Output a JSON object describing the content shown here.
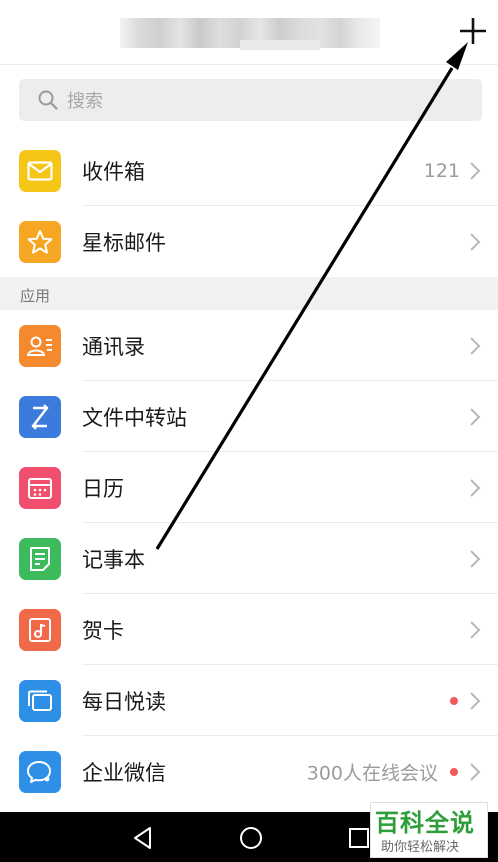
{
  "header": {
    "title_redacted": true,
    "add_icon": "plus-icon"
  },
  "search": {
    "placeholder": "搜索",
    "icon": "search-icon"
  },
  "mail_items": [
    {
      "label": "收件箱",
      "count": "121",
      "icon": "envelope-icon",
      "color": "#F5C518"
    },
    {
      "label": "星标邮件",
      "count": "",
      "icon": "star-icon",
      "color": "#F5A623"
    }
  ],
  "apps_section": {
    "title": "应用"
  },
  "apps": [
    {
      "label": "通讯录",
      "icon": "contacts-icon",
      "color": "#F5892D"
    },
    {
      "label": "文件中转站",
      "icon": "file-transfer-icon",
      "color": "#3B7BDB"
    },
    {
      "label": "日历",
      "icon": "calendar-icon",
      "color": "#F0506E"
    },
    {
      "label": "记事本",
      "icon": "notepad-icon",
      "color": "#3DBB5C"
    },
    {
      "label": "贺卡",
      "icon": "greeting-card-icon",
      "color": "#F06A4A"
    },
    {
      "label": "每日悦读",
      "icon": "reading-icon",
      "color": "#2E8FE6",
      "badge_dot": true
    },
    {
      "label": "企业微信",
      "sub": "300人在线会议",
      "icon": "wework-icon",
      "color": "#2E8FE6",
      "badge_dot": true
    }
  ],
  "colors": {
    "badge_dot": "#F05A5A",
    "watermark_green": "#2E9E3A"
  },
  "navbar": {
    "back": "back-triangle-icon",
    "home": "home-circle-icon",
    "recent": "recent-square-icon"
  },
  "watermark": {
    "main": "百科全说",
    "sub": "助你轻松解决"
  }
}
